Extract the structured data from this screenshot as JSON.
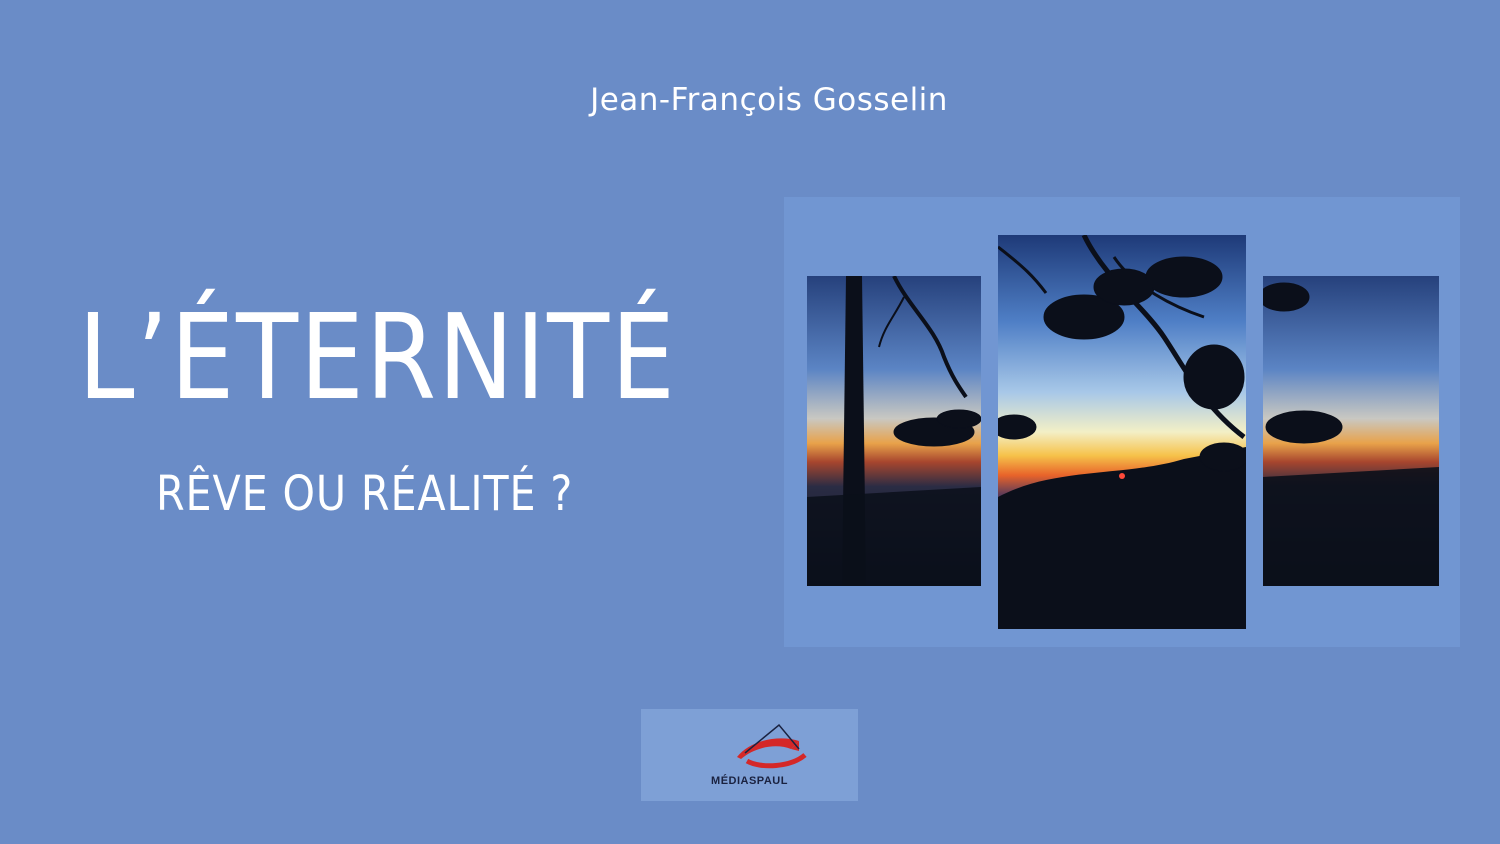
{
  "cover": {
    "author": "Jean-François Gosselin",
    "title": "L’ÉTERNITÉ",
    "subtitle": "RÊVE OU RÉALITÉ ?",
    "publisher": "MÉDIASPAUL"
  },
  "colors": {
    "background": "#6a8cc7",
    "text": "#ffffff",
    "logo_red": "#d42828"
  },
  "image": {
    "description_icon": "sunset-triptych-photo",
    "panels": 3
  }
}
